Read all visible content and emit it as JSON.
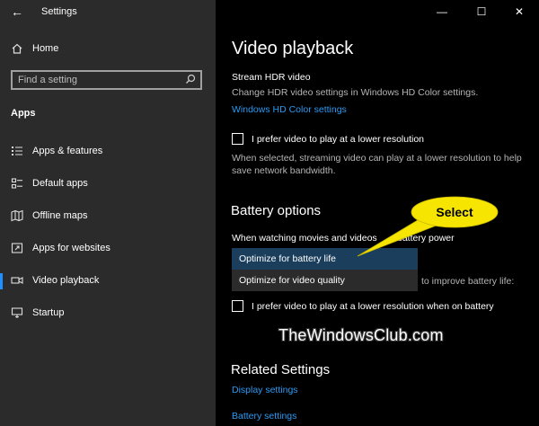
{
  "window": {
    "title": "Settings",
    "controls": {
      "minimize": "—",
      "maximize": "☐",
      "close": "✕"
    }
  },
  "sidebar": {
    "home_label": "Home",
    "search_placeholder": "Find a setting",
    "section_title": "Apps",
    "items": [
      {
        "label": "Apps & features",
        "icon": "apps-list-icon"
      },
      {
        "label": "Default apps",
        "icon": "default-apps-icon"
      },
      {
        "label": "Offline maps",
        "icon": "map-icon"
      },
      {
        "label": "Apps for websites",
        "icon": "website-icon"
      },
      {
        "label": "Video playback",
        "icon": "video-icon",
        "active": true
      },
      {
        "label": "Startup",
        "icon": "startup-icon"
      }
    ],
    "accent_color": "#1e90ff"
  },
  "main": {
    "page_title": "Video playback",
    "hdr": {
      "heading": "Stream HDR video",
      "description": "Change HDR video settings in Windows HD Color settings.",
      "link": "Windows HD Color settings"
    },
    "lower_res": {
      "checkbox_label": "I prefer video to play at a lower resolution",
      "checked": false,
      "description_line1": "When selected, streaming video can play at a lower resolution to help",
      "description_line2": "save network bandwidth."
    },
    "battery": {
      "heading": "Battery options",
      "prompt_visible": "When watching movies and videos",
      "prompt_tail": "battery power",
      "hidden_tail": "to improve battery life:",
      "dropdown_options": [
        "Optimize for battery life",
        "Optimize for video quality"
      ],
      "selected_option": "Optimize for battery life",
      "checkbox_label": "I prefer video to play at a lower resolution when on battery",
      "checked": false
    },
    "related": {
      "heading": "Related Settings",
      "links": [
        "Display settings",
        "Battery settings"
      ]
    },
    "link_color": "#2b9af3"
  },
  "annotation": {
    "callout_text": "Select",
    "callout_color": "#f6e500",
    "watermark": "TheWindowsClub.com"
  }
}
